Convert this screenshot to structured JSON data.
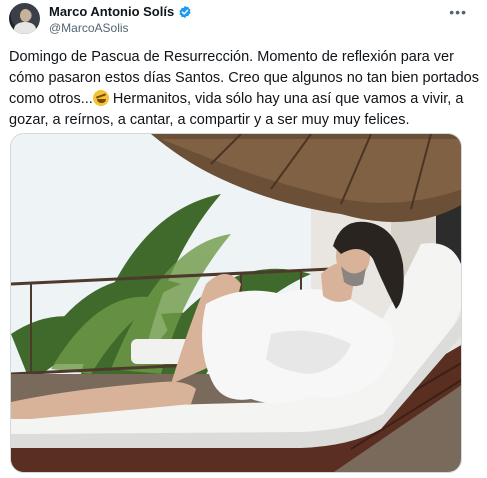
{
  "author": {
    "display_name": "Marco Antonio Solís",
    "handle": "@MarcoASolis",
    "verified_icon": "verified-badge-icon",
    "avatar_icon": "avatar"
  },
  "menu": {
    "more_label": "•••"
  },
  "tweet": {
    "text_before_emoji": "Domingo de Pascua de Resurrección. Momento de reflexión para ver cómo pasaron estos días Santos. Creo que algunos no tan bien portados como otros...",
    "emoji_name": "rolling-on-floor-laughing-emoji",
    "text_after_emoji": " Hermanitos, vida sólo hay una así que vamos a vivir, a gozar, a reírnos, a cantar, a compartir y a ser muy muy felices."
  },
  "media": {
    "type": "photo",
    "colors": {
      "sky": "#eef3f6",
      "palm": "#3f6a2c",
      "thatch": "#6b4f36",
      "wall": "#e9e6e1",
      "lounger": "#f4f4f2",
      "wood": "#5a2f22",
      "robe": "#f7f7f7"
    }
  },
  "colors": {
    "accent": "#1d9bf0",
    "secondary_text": "#536471"
  }
}
